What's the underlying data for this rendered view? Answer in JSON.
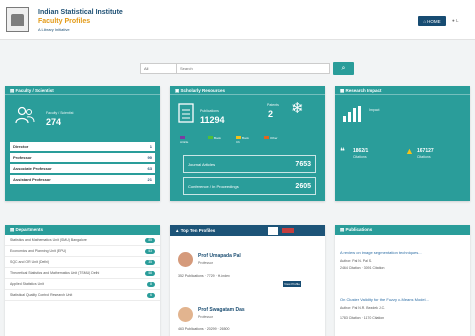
{
  "header": {
    "title": "Indian Statistical Institute",
    "subtitle": "Faculty Profiles",
    "tagline": "A Library Initiative",
    "home_label": "HOME",
    "more_label": "L"
  },
  "search": {
    "select_value": "All",
    "placeholder": "Search"
  },
  "faculty": {
    "title": "Faculty / Scientist",
    "count_label": "Faculty / Scientist",
    "count": "274",
    "rows": [
      {
        "label": "Director",
        "value": "1"
      },
      {
        "label": "Professor",
        "value": "90"
      },
      {
        "label": "Associate Professor",
        "value": "63"
      },
      {
        "label": "Assistant Professor",
        "value": "21"
      }
    ]
  },
  "resources": {
    "title": "Scholarly Resources",
    "pubs_label": "Publications",
    "pubs": "11294",
    "patents_label": "Patents",
    "patents": "2",
    "legend": [
      {
        "label": "Article",
        "color": "#7b3da2"
      },
      {
        "label": "Book",
        "color": "#4fbf3a"
      },
      {
        "label": "Book Ch",
        "color": "#f3c21a"
      },
      {
        "label": "Other",
        "color": "#e0651e"
      }
    ],
    "rows": [
      {
        "label": "Journal Articles",
        "value": "7653"
      },
      {
        "label": "Conference / In Proceedings",
        "value": "2605"
      }
    ]
  },
  "impact": {
    "title": "Research Impact",
    "label": "Impact",
    "c1_value": "1862/1",
    "c1_label": "Citations",
    "c2_value": "167127",
    "c2_label": "Citations"
  },
  "departments": {
    "title": "Departments",
    "items": [
      {
        "name": "Statistics and Mathematics Unit (SMU) Bangalore",
        "count": "85"
      },
      {
        "name": "Economics and Planning Unit (EPU)",
        "count": "53"
      },
      {
        "name": "SQC and OR Unit (Delhi)",
        "count": "35"
      },
      {
        "name": "Theoretical Statistics and Mathematics Unit (TSMU) Delhi",
        "count": "58"
      },
      {
        "name": "Applied Statistics Unit",
        "count": "8"
      },
      {
        "name": "Statistical Quality Control Research Unit",
        "count": "6"
      }
    ]
  },
  "top": {
    "title": "Top Ten Profiles",
    "profiles": [
      {
        "name": "Prof Umapada Pal",
        "role": "Professor",
        "pubs": "352 Publications",
        "cites": "7729",
        "extra": "H-index",
        "view": "View Profile"
      },
      {
        "name": "Prof Swagatam Das",
        "role": "Professor",
        "pubs": "463 Publications",
        "cites": "20299",
        "extra": "26500"
      }
    ]
  },
  "pubs": {
    "title": "Publications",
    "items": [
      {
        "title": "A review on image segmentation techniques...",
        "author": "Author: Pal N. Pal S.",
        "meta1": "2464 Citation",
        "meta2": "3091 Citation"
      },
      {
        "title": "On Cluster Validity for the Fuzzy c-Means Model...",
        "author": "Author: Pal N.R. Bezdek J.C.",
        "meta1": "1783 Citation",
        "meta2": "1170 Citation"
      }
    ]
  }
}
